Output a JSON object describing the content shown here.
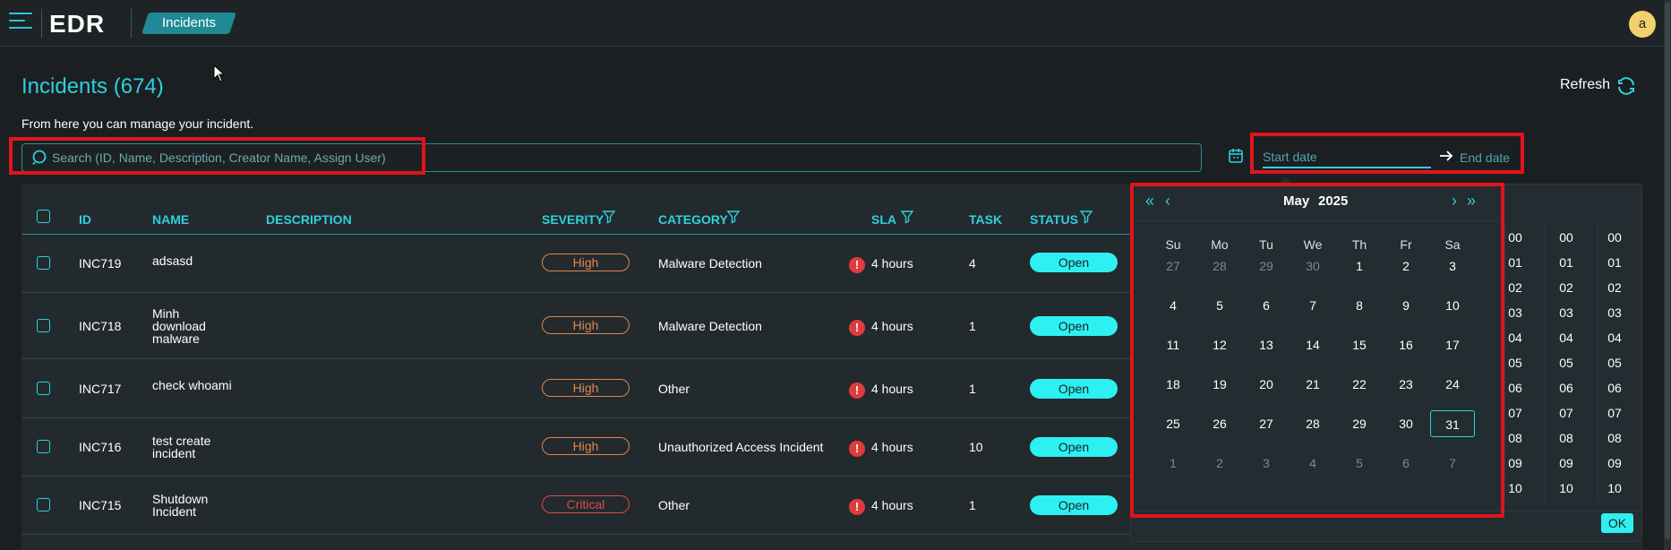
{
  "app": {
    "logo": "EDR",
    "breadcrumb": "Incidents",
    "avatar_initial": "a"
  },
  "page": {
    "title": "Incidents (674)",
    "description": "From here you can manage your incident.",
    "refresh_label": "Refresh",
    "search_placeholder": "Search (ID, Name, Description, Creator Name, Assign User)",
    "start_date_placeholder": "Start date",
    "end_date_placeholder": "End date"
  },
  "table": {
    "headers": {
      "id": "ID",
      "name": "NAME",
      "description": "DESCRIPTION",
      "severity": "SEVERITY",
      "category": "CATEGORY",
      "sla": "SLA",
      "task": "TASK",
      "status": "STATUS"
    },
    "rows": [
      {
        "id": "INC719",
        "name": "adsasd",
        "severity": "High",
        "category": "Malware Detection",
        "sla_icon": "!",
        "sla": "4 hours",
        "task": "4",
        "status": "Open"
      },
      {
        "id": "INC718",
        "name": "Minh download malware",
        "severity": "High",
        "category": "Malware Detection",
        "sla_icon": "!",
        "sla": "4 hours",
        "task": "1",
        "status": "Open"
      },
      {
        "id": "INC717",
        "name": "check whoami",
        "severity": "High",
        "category": "Other",
        "sla_icon": "!",
        "sla": "4 hours",
        "task": "1",
        "status": "Open"
      },
      {
        "id": "INC716",
        "name": "test create incident",
        "severity": "High",
        "category": "Unauthorized Access Incident",
        "sla_icon": "!",
        "sla": "4 hours",
        "task": "10",
        "status": "Open"
      },
      {
        "id": "INC715",
        "name": "Shutdown Incident",
        "severity": "Critical",
        "category": "Other",
        "sla_icon": "!",
        "sla": "4 hours",
        "task": "1",
        "status": "Open"
      }
    ]
  },
  "picker": {
    "month": "May",
    "year": "2025",
    "nav": {
      "prev_year": "«",
      "prev_month": "‹",
      "next_month": "›",
      "next_year": "»"
    },
    "weekdays": [
      "Su",
      "Mo",
      "Tu",
      "We",
      "Th",
      "Fr",
      "Sa"
    ],
    "weeks": [
      [
        "27",
        "28",
        "29",
        "30",
        "1",
        "2",
        "3"
      ],
      [
        "4",
        "5",
        "6",
        "7",
        "8",
        "9",
        "10"
      ],
      [
        "11",
        "12",
        "13",
        "14",
        "15",
        "16",
        "17"
      ],
      [
        "18",
        "19",
        "20",
        "21",
        "22",
        "23",
        "24"
      ],
      [
        "25",
        "26",
        "27",
        "28",
        "29",
        "30",
        "31"
      ],
      [
        "1",
        "2",
        "3",
        "4",
        "5",
        "6",
        "7"
      ]
    ],
    "selected_day": "31",
    "time_values": [
      "00",
      "01",
      "02",
      "03",
      "04",
      "05",
      "06",
      "07",
      "08",
      "09",
      "10"
    ],
    "ok_label": "OK"
  },
  "colors": {
    "accent": "#2ed0dd",
    "high": "#e0854a",
    "critical": "#e04848",
    "highlight_box": "#e0141c"
  }
}
